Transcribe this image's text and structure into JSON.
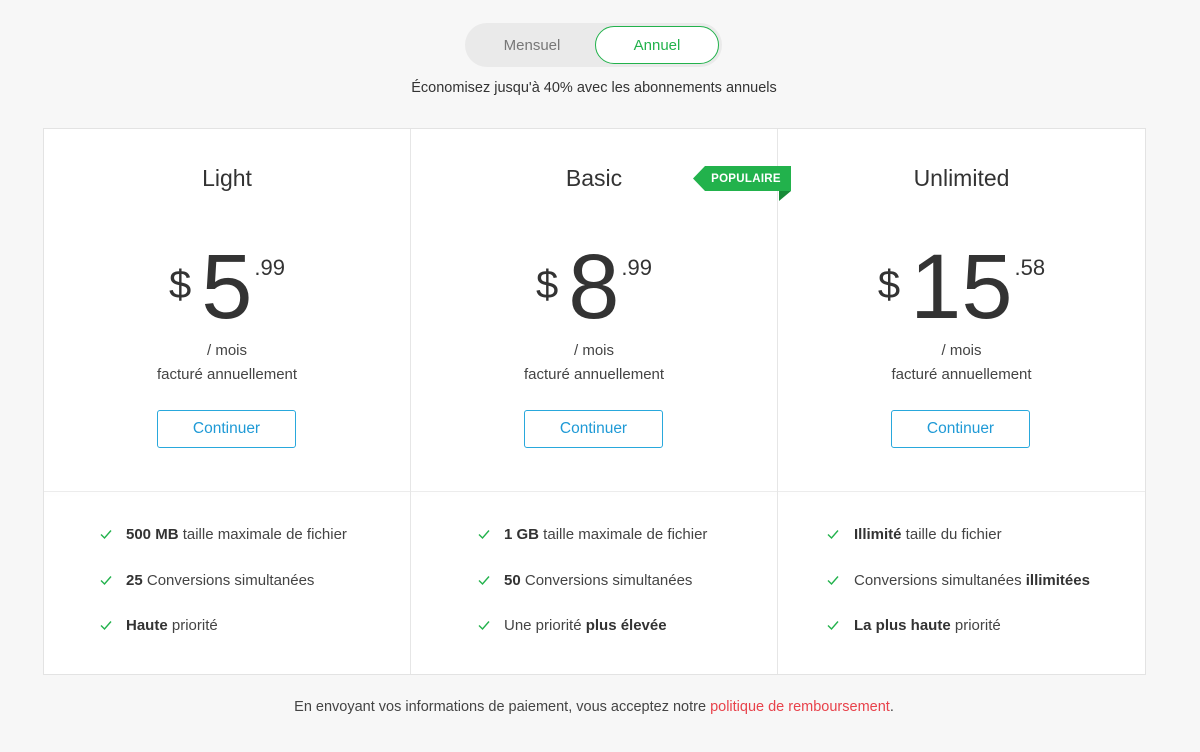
{
  "billing_toggle": {
    "monthly_label": "Mensuel",
    "annual_label": "Annuel",
    "selected": "Annuel"
  },
  "savings_note": "Économisez jusqu'à 40% avec les abonnements annuels",
  "popular_badge": "POPULAIRE",
  "colors": {
    "accent_green": "#22b24c",
    "cta_blue": "#1f9ad6",
    "link_red": "#e8424b"
  },
  "plans": [
    {
      "name": "Light",
      "currency": "$",
      "price_int": "5",
      "price_dec": ".99",
      "period": "/ mois",
      "billing": "facturé annuellement",
      "cta": "Continuer",
      "features": [
        {
          "pre": "",
          "bold": "500 MB",
          "post": " taille maximale de fichier"
        },
        {
          "pre": "",
          "bold": "25",
          "post": " Conversions simultanées"
        },
        {
          "pre": "",
          "bold": "Haute",
          "post": " priorité"
        }
      ]
    },
    {
      "name": "Basic",
      "currency": "$",
      "price_int": "8",
      "price_dec": ".99",
      "period": "/ mois",
      "billing": "facturé annuellement",
      "cta": "Continuer",
      "features": [
        {
          "pre": "",
          "bold": "1 GB",
          "post": " taille maximale de fichier"
        },
        {
          "pre": "",
          "bold": "50",
          "post": " Conversions simultanées"
        },
        {
          "pre": "Une priorité ",
          "bold": "plus élevée",
          "post": ""
        }
      ]
    },
    {
      "name": "Unlimited",
      "currency": "$",
      "price_int": "15",
      "price_dec": ".58",
      "period": "/ mois",
      "billing": "facturé annuellement",
      "cta": "Continuer",
      "features": [
        {
          "pre": "",
          "bold": "Illimité",
          "post": " taille du fichier"
        },
        {
          "pre": "Conversions simultanées ",
          "bold": "illimitées",
          "post": ""
        },
        {
          "pre": "",
          "bold": "La plus haute",
          "post": " priorité"
        }
      ]
    }
  ],
  "footer": {
    "text": "En envoyant vos informations de paiement, vous acceptez notre ",
    "link": "politique de remboursement",
    "end": "."
  }
}
